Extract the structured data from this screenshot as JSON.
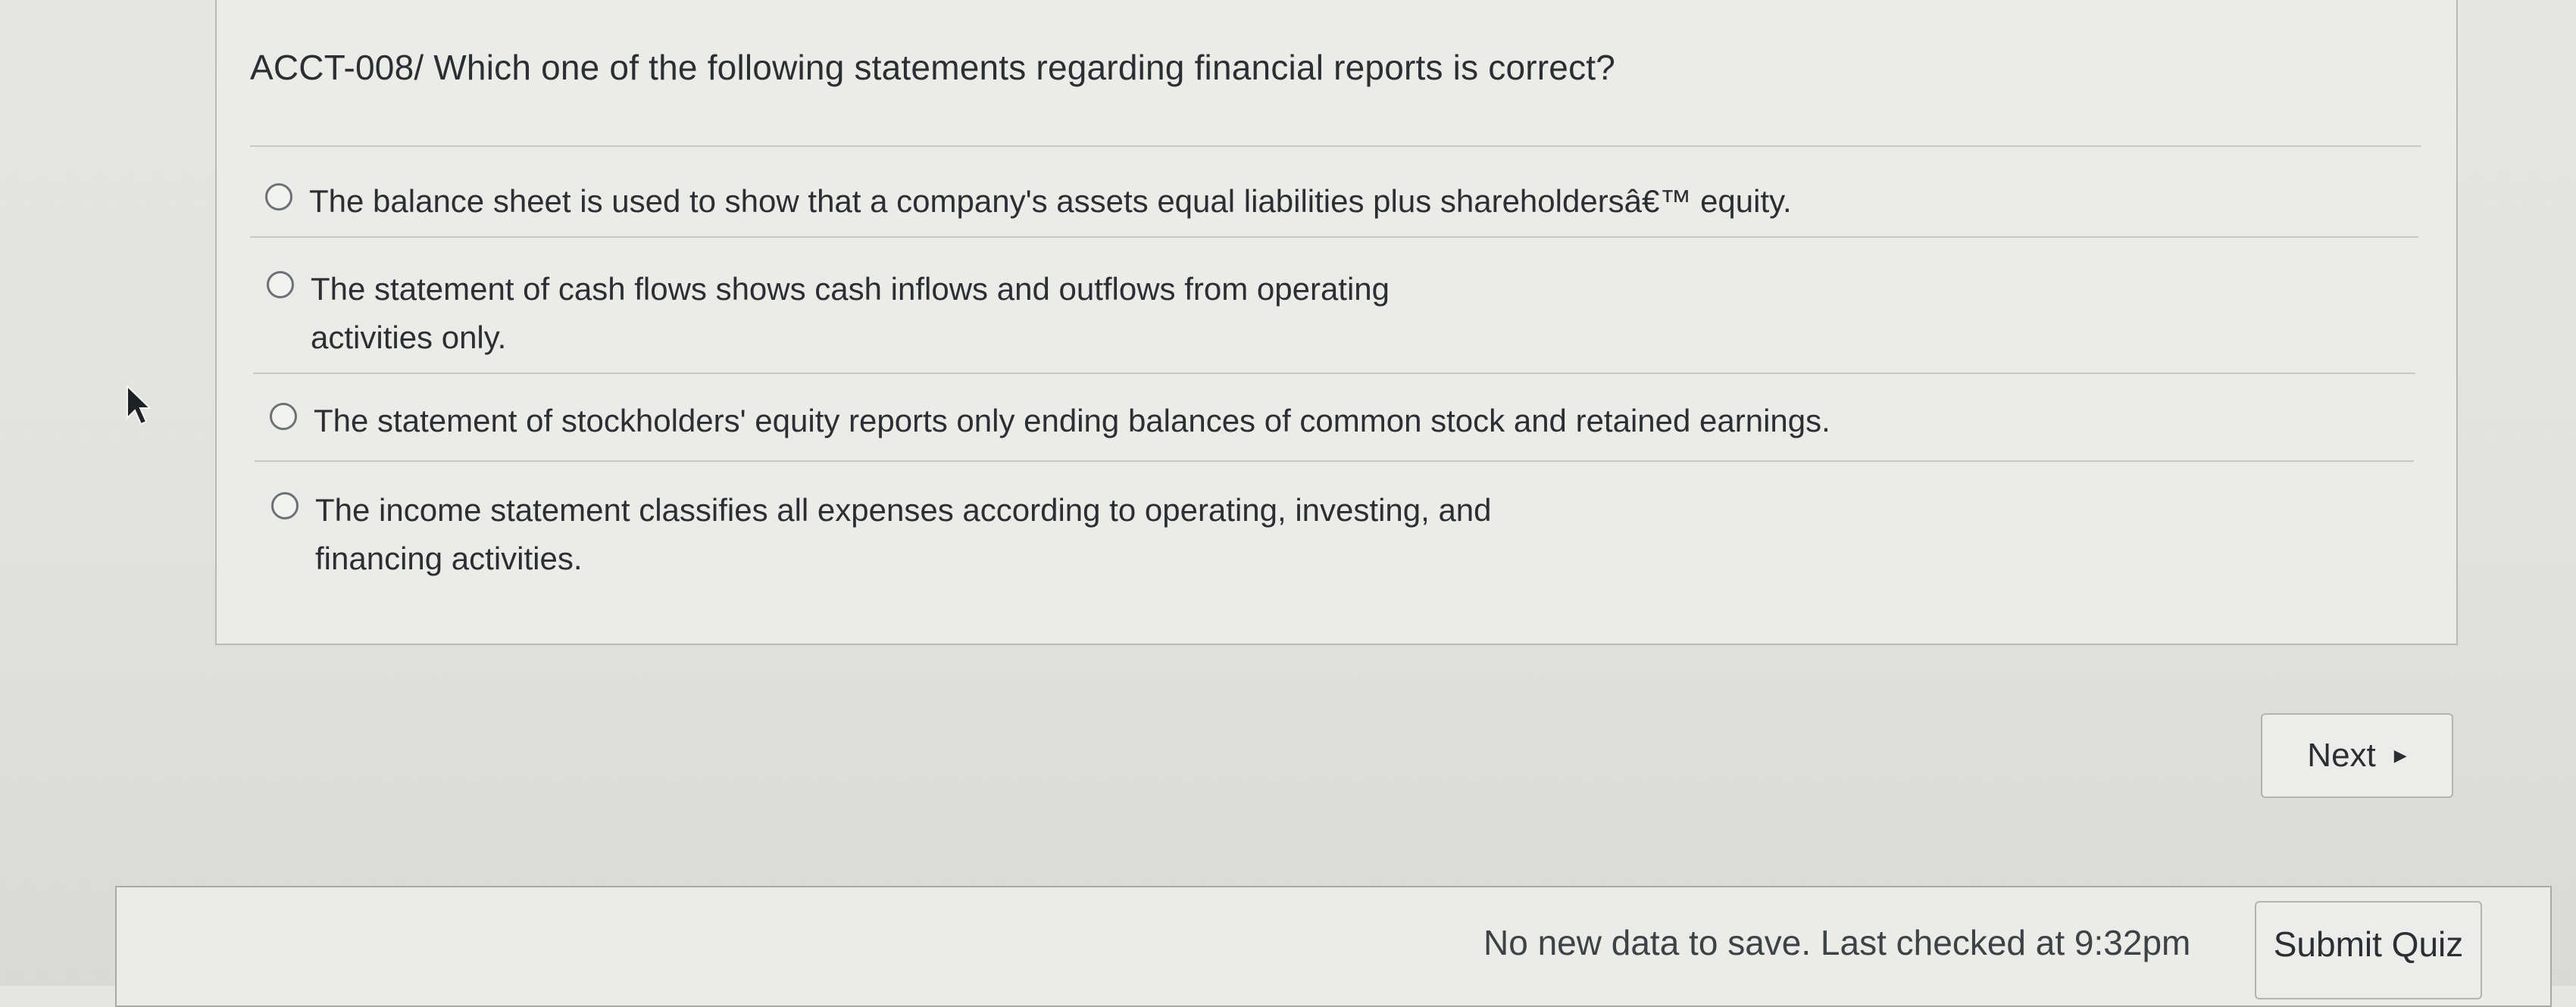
{
  "question": {
    "text": "ACCT-008/ Which one of the following statements regarding financial reports is correct?"
  },
  "answers": [
    {
      "label_lines": [
        "The balance sheet is used to show that a company's assets equal liabilities plus shareholdersâ€™ equity."
      ],
      "selected": false
    },
    {
      "label_lines": [
        "The statement of cash flows shows cash inflows and outflows from operating",
        "activities only."
      ],
      "selected": false
    },
    {
      "label_lines": [
        "The statement of stockholders' equity reports only ending balances of common stock and retained earnings."
      ],
      "selected": false
    },
    {
      "label_lines": [
        "The income statement classifies all expenses according to operating, investing, and",
        "financing activities."
      ],
      "selected": false
    }
  ],
  "navigation": {
    "next_label": "Next",
    "next_icon": "play-arrow-icon"
  },
  "footer": {
    "save_status": "No new data to save. Last checked at 9:32pm",
    "submit_label": "Submit Quiz"
  },
  "colors": {
    "text": "#2b2f33",
    "border": "#b3b3b0",
    "background": "#e4e4e1"
  }
}
